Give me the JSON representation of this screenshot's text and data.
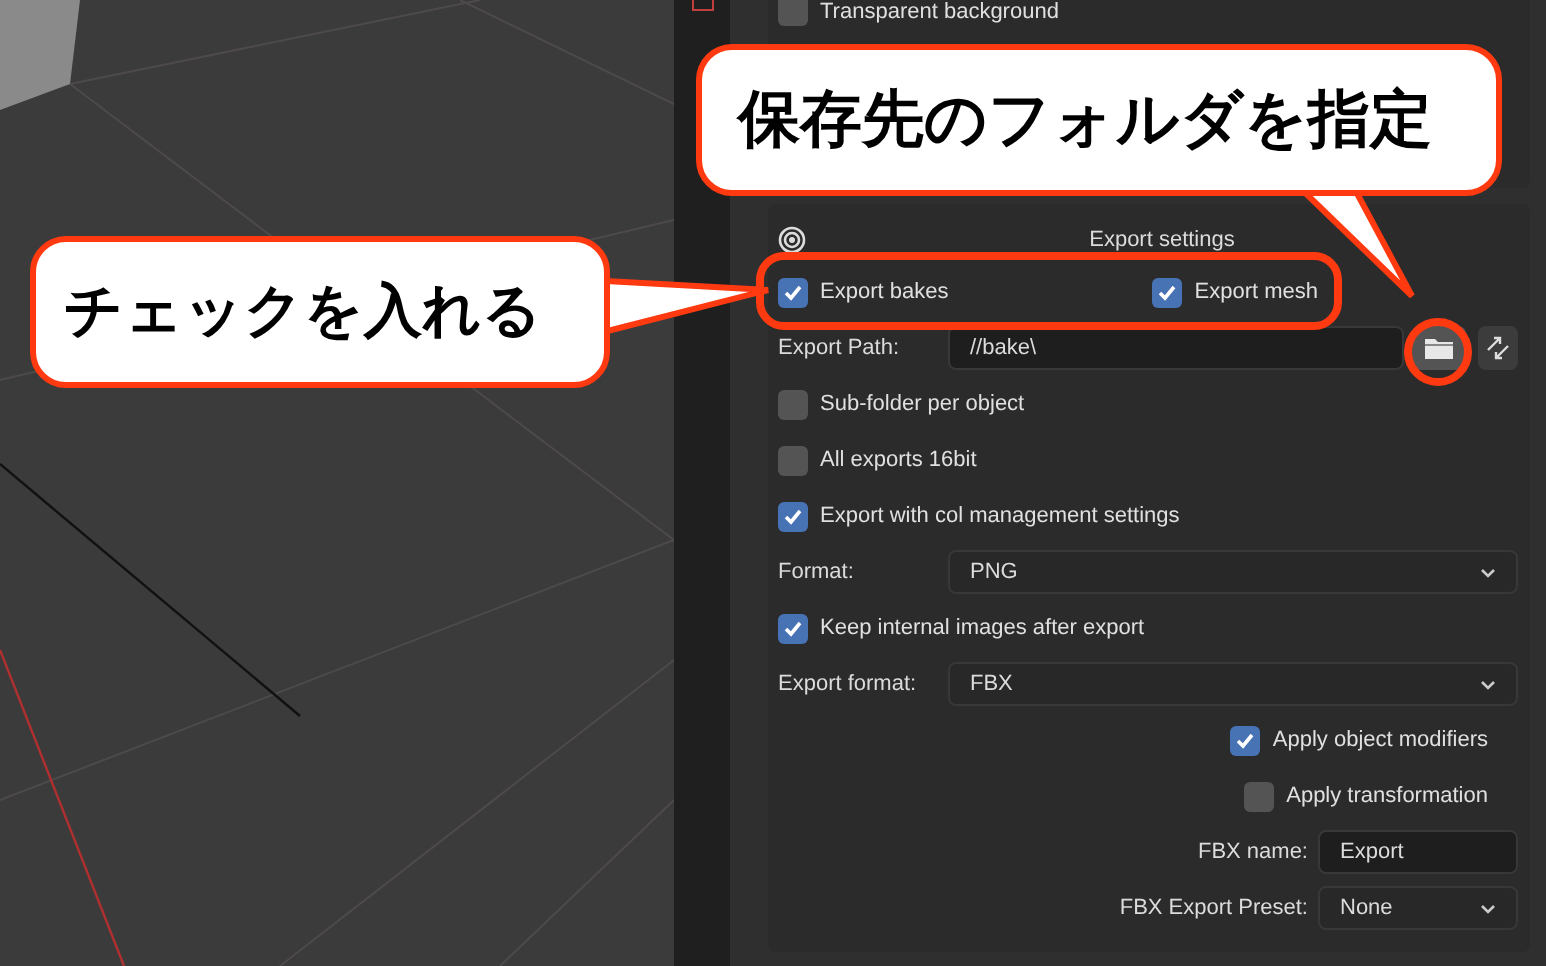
{
  "top_row": {
    "label": "Transparent background",
    "checked": false
  },
  "panel": {
    "title": "Export settings",
    "rows": [
      {
        "kind": "check_pair",
        "items": [
          {
            "label": "Export bakes",
            "checked": true
          },
          {
            "label": "Export mesh",
            "checked": true
          }
        ]
      },
      {
        "kind": "path",
        "label": "Export Path:",
        "value": "//bake\\"
      },
      {
        "kind": "check",
        "label": "Sub-folder per object",
        "checked": false
      },
      {
        "kind": "check",
        "label": "All exports 16bit",
        "checked": false
      },
      {
        "kind": "check",
        "label": "Export with col management settings",
        "checked": true
      },
      {
        "kind": "dropdown",
        "label": "Format:",
        "value": "PNG"
      },
      {
        "kind": "check",
        "label": "Keep internal images after export",
        "checked": true
      },
      {
        "kind": "dropdown",
        "label": "Export format:",
        "value": "FBX"
      },
      {
        "kind": "check_right",
        "label": "Apply object modifiers",
        "checked": true
      },
      {
        "kind": "check_right",
        "label": "Apply transformation",
        "checked": false
      },
      {
        "kind": "text_right",
        "label": "FBX name:",
        "value": "Export"
      },
      {
        "kind": "dropdown_right",
        "label": "FBX Export Preset:",
        "value": "None"
      }
    ]
  },
  "callouts": [
    {
      "text": "保存先のフォルダを指定"
    },
    {
      "text": "チェックを入れる"
    }
  ]
}
